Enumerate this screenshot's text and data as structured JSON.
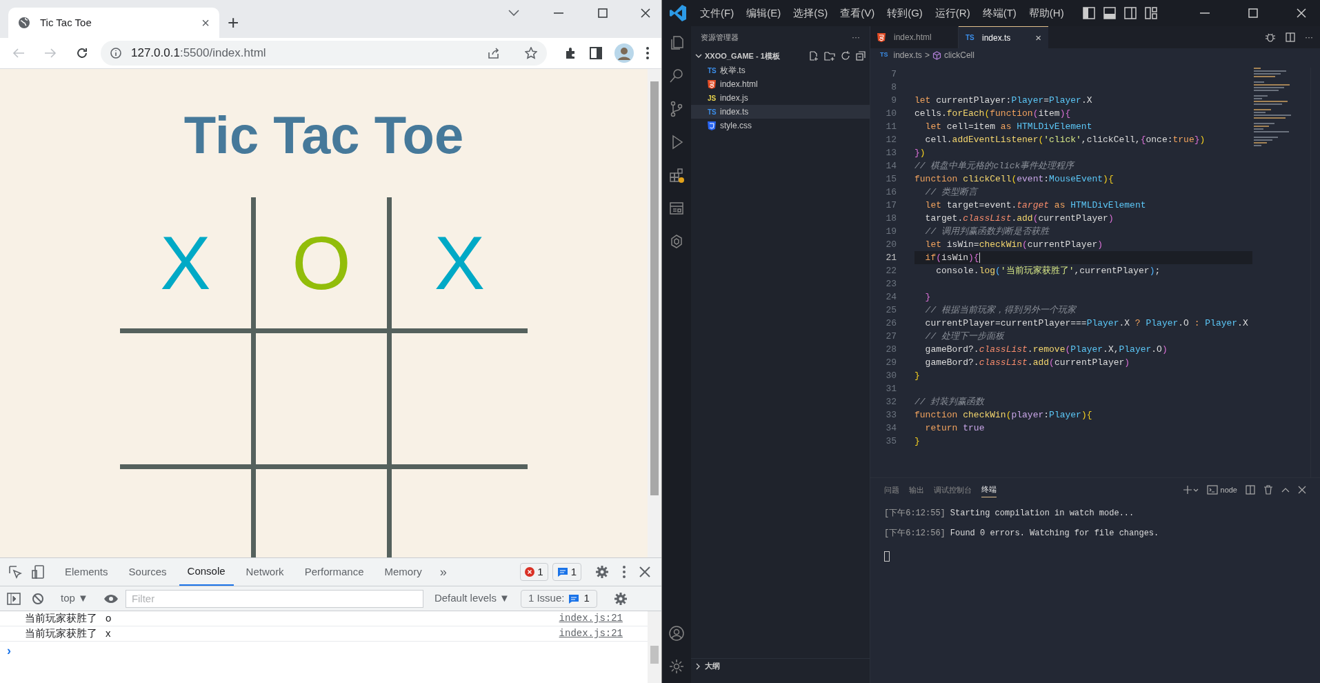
{
  "browser": {
    "tab": {
      "title": "Tic Tac Toe",
      "close": "×"
    },
    "new_tab": "+",
    "url": {
      "host": "127.0.0.1",
      "rest": ":5500/index.html"
    },
    "page": {
      "title": "Tic Tac Toe",
      "cells": [
        {
          "kind": "x",
          "mark": "X"
        },
        {
          "kind": "o",
          "mark": "O"
        },
        {
          "kind": "x",
          "mark": "X"
        },
        {
          "kind": "empty"
        },
        {
          "kind": "empty"
        },
        {
          "kind": "empty"
        },
        {
          "kind": "empty"
        },
        {
          "kind": "empty"
        },
        {
          "kind": "empty"
        }
      ]
    },
    "devtools": {
      "tabs": [
        {
          "label": "Elements",
          "selected": false
        },
        {
          "label": "Sources",
          "selected": false
        },
        {
          "label": "Console",
          "selected": true
        },
        {
          "label": "Network",
          "selected": false
        },
        {
          "label": "Performance",
          "selected": false
        },
        {
          "label": "Memory",
          "selected": false
        }
      ],
      "more": "»",
      "error_count": "1",
      "message_count": "1",
      "context": "top ▼",
      "filter_placeholder": "Filter",
      "levels": "Default levels ▼",
      "issues": "1 Issue:",
      "issue_count": "1",
      "messages": [
        {
          "text": "当前玩家获胜了",
          "value": "o",
          "source": "index.js:21"
        },
        {
          "text": "当前玩家获胜了",
          "value": "x",
          "source": "index.js:21"
        }
      ],
      "prompt": "›"
    }
  },
  "vscode": {
    "menu": [
      "文件(F)",
      "编辑(E)",
      "选择(S)",
      "查看(V)",
      "转到(G)",
      "运行(R)",
      "终端(T)",
      "帮助(H)"
    ],
    "explorer": {
      "title": "资源管理器",
      "more": "···",
      "folder": "XXOO_GAME - 1模板",
      "files": [
        {
          "kind": "ts",
          "badge": "TS",
          "name": "枚举.ts",
          "selected": false
        },
        {
          "kind": "html",
          "name": "index.html",
          "selected": false
        },
        {
          "kind": "js",
          "badge": "JS",
          "name": "index.js",
          "selected": false
        },
        {
          "kind": "ts",
          "badge": "TS",
          "name": "index.ts",
          "selected": true
        },
        {
          "kind": "css",
          "name": "style.css",
          "selected": false
        }
      ],
      "sections": [
        "大纲"
      ]
    },
    "tabs": [
      {
        "kind": "html",
        "label": "index.html",
        "selected": false
      },
      {
        "kind": "ts",
        "badge": "TS",
        "label": "index.ts",
        "selected": true,
        "close": "×"
      }
    ],
    "breadcrumb": {
      "badge": "TS",
      "file": "index.ts",
      "sep": ">",
      "symbol": "clickCell"
    },
    "code": [
      {
        "n": "7"
      },
      {
        "n": "8"
      },
      {
        "n": "9",
        "t": [
          {
            "kind": "keyword",
            "text": "let"
          },
          {
            "kind": "plain",
            "text": " currentPlayer:"
          },
          {
            "kind": "type",
            "text": "Player"
          },
          {
            "kind": "plain",
            "text": "="
          },
          {
            "kind": "type",
            "text": "Player"
          },
          {
            "kind": "plain",
            "text": ".X"
          }
        ]
      },
      {
        "n": "10",
        "t": [
          {
            "kind": "plain",
            "text": "cells."
          },
          {
            "kind": "function",
            "text": "forEach"
          },
          {
            "kind": "bracket1",
            "text": "("
          },
          {
            "kind": "keyword",
            "text": "function"
          },
          {
            "kind": "bracket2",
            "text": "("
          },
          {
            "kind": "plain",
            "text": "item"
          },
          {
            "kind": "bracket2",
            "text": ")"
          },
          {
            "kind": "bracket2",
            "text": "{"
          }
        ]
      },
      {
        "n": "11",
        "t": [
          {
            "kind": "keyword",
            "text": "  let"
          },
          {
            "kind": "plain",
            "text": " cell=item "
          },
          {
            "kind": "keyword",
            "text": "as"
          },
          {
            "kind": "type",
            "text": " HTMLDivElement"
          }
        ]
      },
      {
        "n": "12",
        "t": [
          {
            "kind": "plain",
            "text": "  cell."
          },
          {
            "kind": "function",
            "text": "addEventListener"
          },
          {
            "kind": "bracket1",
            "text": "("
          },
          {
            "kind": "string",
            "text": "'click'"
          },
          {
            "kind": "plain",
            "text": ",clickCell,"
          },
          {
            "kind": "bracket2",
            "text": "{"
          },
          {
            "kind": "plain",
            "text": "once:"
          },
          {
            "kind": "keyword",
            "text": "true"
          },
          {
            "kind": "bracket2",
            "text": "}"
          },
          {
            "kind": "bracket1",
            "text": ")"
          }
        ]
      },
      {
        "n": "13",
        "t": [
          {
            "kind": "bracket2",
            "text": "}"
          },
          {
            "kind": "bracket1",
            "text": ")"
          }
        ]
      },
      {
        "n": "14",
        "t": [
          {
            "kind": "comment",
            "text": "// 棋盘中单元格的click事件处理程序"
          }
        ]
      },
      {
        "n": "15",
        "t": [
          {
            "kind": "keyword",
            "text": "function"
          },
          {
            "kind": "function",
            "text": " clickCell"
          },
          {
            "kind": "bracket1",
            "text": "("
          },
          {
            "kind": "param",
            "text": "event"
          },
          {
            "kind": "plain",
            "text": ":"
          },
          {
            "kind": "type",
            "text": "MouseEvent"
          },
          {
            "kind": "bracket1",
            "text": ")"
          },
          {
            "kind": "bracket1",
            "text": "{"
          }
        ]
      },
      {
        "n": "16",
        "t": [
          {
            "kind": "comment",
            "text": "  // 类型断言"
          }
        ]
      },
      {
        "n": "17",
        "t": [
          {
            "kind": "keyword",
            "text": "  let"
          },
          {
            "kind": "plain",
            "text": " target=event."
          },
          {
            "kind": "property",
            "text": "target"
          },
          {
            "kind": "keyword",
            "text": " as "
          },
          {
            "kind": "type",
            "text": "HTMLDivElement"
          }
        ]
      },
      {
        "n": "18",
        "t": [
          {
            "kind": "plain",
            "text": "  target."
          },
          {
            "kind": "property",
            "text": "classList"
          },
          {
            "kind": "plain",
            "text": "."
          },
          {
            "kind": "function",
            "text": "add"
          },
          {
            "kind": "bracket2",
            "text": "("
          },
          {
            "kind": "plain",
            "text": "currentPlayer"
          },
          {
            "kind": "bracket2",
            "text": ")"
          }
        ]
      },
      {
        "n": "19",
        "t": [
          {
            "kind": "comment",
            "text": "  // 调用判赢函数判断是否获胜"
          }
        ]
      },
      {
        "n": "20",
        "t": [
          {
            "kind": "keyword",
            "text": "  let"
          },
          {
            "kind": "plain",
            "text": " isWin="
          },
          {
            "kind": "function",
            "text": "checkWin"
          },
          {
            "kind": "bracket2",
            "text": "("
          },
          {
            "kind": "plain",
            "text": "currentPlayer"
          },
          {
            "kind": "bracket2",
            "text": ")"
          }
        ]
      },
      {
        "n": "21",
        "current": true,
        "t": [
          {
            "kind": "keyword",
            "text": "  if"
          },
          {
            "kind": "bracket2",
            "text": "("
          },
          {
            "kind": "plain",
            "text": "isWin"
          },
          {
            "kind": "bracket2",
            "text": ")"
          },
          {
            "kind": "bracket2",
            "text": "{"
          }
        ]
      },
      {
        "n": "22",
        "t": [
          {
            "kind": "plain",
            "text": "    console."
          },
          {
            "kind": "function",
            "text": "log"
          },
          {
            "kind": "bracket3",
            "text": "("
          },
          {
            "kind": "string",
            "text": "'当前玩家获胜了'"
          },
          {
            "kind": "plain",
            "text": ",currentPlayer"
          },
          {
            "kind": "bracket3",
            "text": ")"
          },
          {
            "kind": "plain",
            "text": ";"
          }
        ]
      },
      {
        "n": "23"
      },
      {
        "n": "24",
        "t": [
          {
            "kind": "bracket2",
            "text": "  }"
          }
        ]
      },
      {
        "n": "25",
        "t": [
          {
            "kind": "comment",
            "text": "  // 根据当前玩家，得到另外一个玩家"
          }
        ]
      },
      {
        "n": "26",
        "t": [
          {
            "kind": "plain",
            "text": "  currentPlayer=currentPlayer==="
          },
          {
            "kind": "type",
            "text": "Player"
          },
          {
            "kind": "plain",
            "text": ".X "
          },
          {
            "kind": "keyword",
            "text": "?"
          },
          {
            "kind": "type",
            "text": " Player"
          },
          {
            "kind": "plain",
            "text": ".O "
          },
          {
            "kind": "keyword",
            "text": ":"
          },
          {
            "kind": "type",
            "text": " Player"
          },
          {
            "kind": "plain",
            "text": ".X"
          }
        ]
      },
      {
        "n": "27",
        "t": [
          {
            "kind": "comment",
            "text": "  // 处理下一步面板"
          }
        ]
      },
      {
        "n": "28",
        "t": [
          {
            "kind": "plain",
            "text": "  gameBord?."
          },
          {
            "kind": "property",
            "text": "classList"
          },
          {
            "kind": "plain",
            "text": "."
          },
          {
            "kind": "function",
            "text": "remove"
          },
          {
            "kind": "bracket2",
            "text": "("
          },
          {
            "kind": "type",
            "text": "Player"
          },
          {
            "kind": "plain",
            "text": ".X,"
          },
          {
            "kind": "type",
            "text": "Player"
          },
          {
            "kind": "plain",
            "text": ".O"
          },
          {
            "kind": "bracket2",
            "text": ")"
          }
        ]
      },
      {
        "n": "29",
        "t": [
          {
            "kind": "plain",
            "text": "  gameBord?."
          },
          {
            "kind": "property",
            "text": "classList"
          },
          {
            "kind": "plain",
            "text": "."
          },
          {
            "kind": "function",
            "text": "add"
          },
          {
            "kind": "bracket2",
            "text": "("
          },
          {
            "kind": "plain",
            "text": "currentPlayer"
          },
          {
            "kind": "bracket2",
            "text": ")"
          }
        ]
      },
      {
        "n": "30",
        "t": [
          {
            "kind": "bracket1",
            "text": "}"
          }
        ]
      },
      {
        "n": "31"
      },
      {
        "n": "32",
        "t": [
          {
            "kind": "comment",
            "text": "// 封装判赢函数"
          }
        ]
      },
      {
        "n": "33",
        "t": [
          {
            "kind": "keyword",
            "text": "function"
          },
          {
            "kind": "function",
            "text": " checkWin"
          },
          {
            "kind": "bracket1",
            "text": "("
          },
          {
            "kind": "param",
            "text": "player"
          },
          {
            "kind": "plain",
            "text": ":"
          },
          {
            "kind": "type",
            "text": "Player"
          },
          {
            "kind": "bracket1",
            "text": ")"
          },
          {
            "kind": "bracket1",
            "text": "{"
          }
        ]
      },
      {
        "n": "34",
        "t": [
          {
            "kind": "keyword",
            "text": "  return"
          },
          {
            "kind": "constant",
            "text": " true"
          }
        ]
      },
      {
        "n": "35",
        "t": [
          {
            "kind": "bracket1",
            "text": "}"
          }
        ]
      }
    ],
    "panel": {
      "tabs": [
        {
          "label": "问题",
          "selected": false
        },
        {
          "label": "输出",
          "selected": false
        },
        {
          "label": "调试控制台",
          "selected": false
        },
        {
          "label": "终端",
          "selected": true
        }
      ],
      "shell": "node",
      "lines": [
        {
          "time": "[下午6:12:55]",
          "text": "Starting compilation in watch mode..."
        },
        {
          "time": "[下午6:12:56]",
          "text": "Found 0 errors. Watching for file changes."
        }
      ]
    }
  }
}
